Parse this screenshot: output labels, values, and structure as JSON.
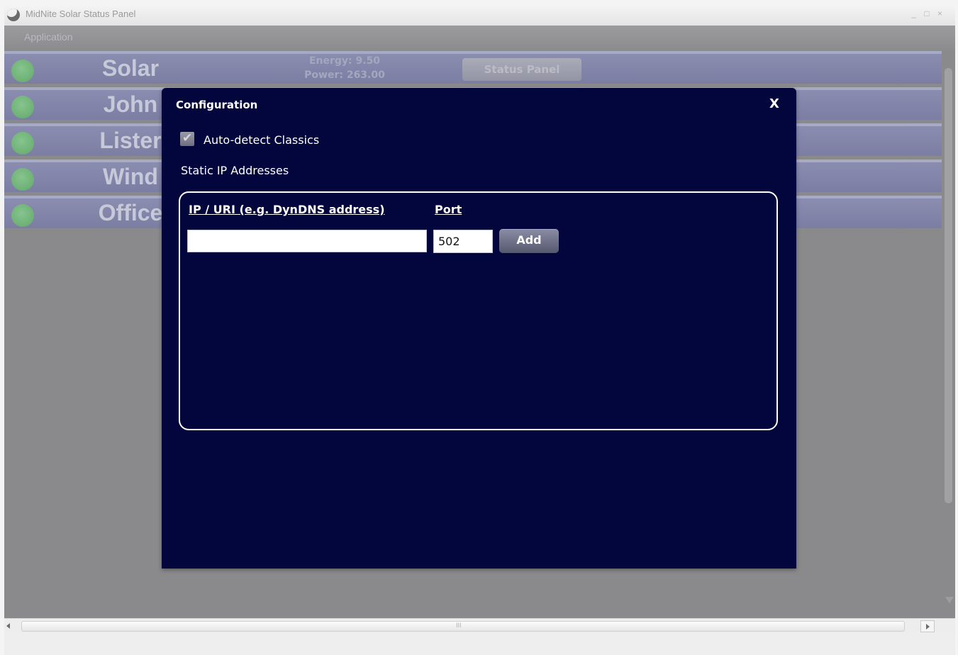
{
  "window": {
    "title": "MidNite Solar Status Panel",
    "controls": "_ □ ×"
  },
  "menu": {
    "items": [
      "Application"
    ]
  },
  "stations": [
    {
      "name": "Solar",
      "status_color": "#6cb474"
    },
    {
      "name": "John",
      "status_color": "#6cb474"
    },
    {
      "name": "Lister",
      "status_color": "#6cb474"
    },
    {
      "name": "Wind",
      "status_color": "#6cb474"
    },
    {
      "name": "Office",
      "status_color": "#6cb474"
    }
  ],
  "solar_summary": {
    "energy": "Energy: 9.50",
    "power": "Power: 263.00",
    "status_button": "Status Panel"
  },
  "dialog": {
    "title": "Configuration",
    "close_label": "X",
    "auto_detect_label": "Auto-detect Classics",
    "auto_detect_checked": true,
    "static_ip_label": "Static IP Addresses",
    "ip_column_header": "IP / URI (e.g. DynDNS address)",
    "port_column_header": "Port",
    "ip_value": "",
    "port_value": "502",
    "add_button": "Add"
  },
  "scrollbar": {
    "grip": "III"
  },
  "colors": {
    "dialog_bg": "#03053d",
    "row_bg": "#8083a6",
    "status_green": "#6cb474"
  }
}
